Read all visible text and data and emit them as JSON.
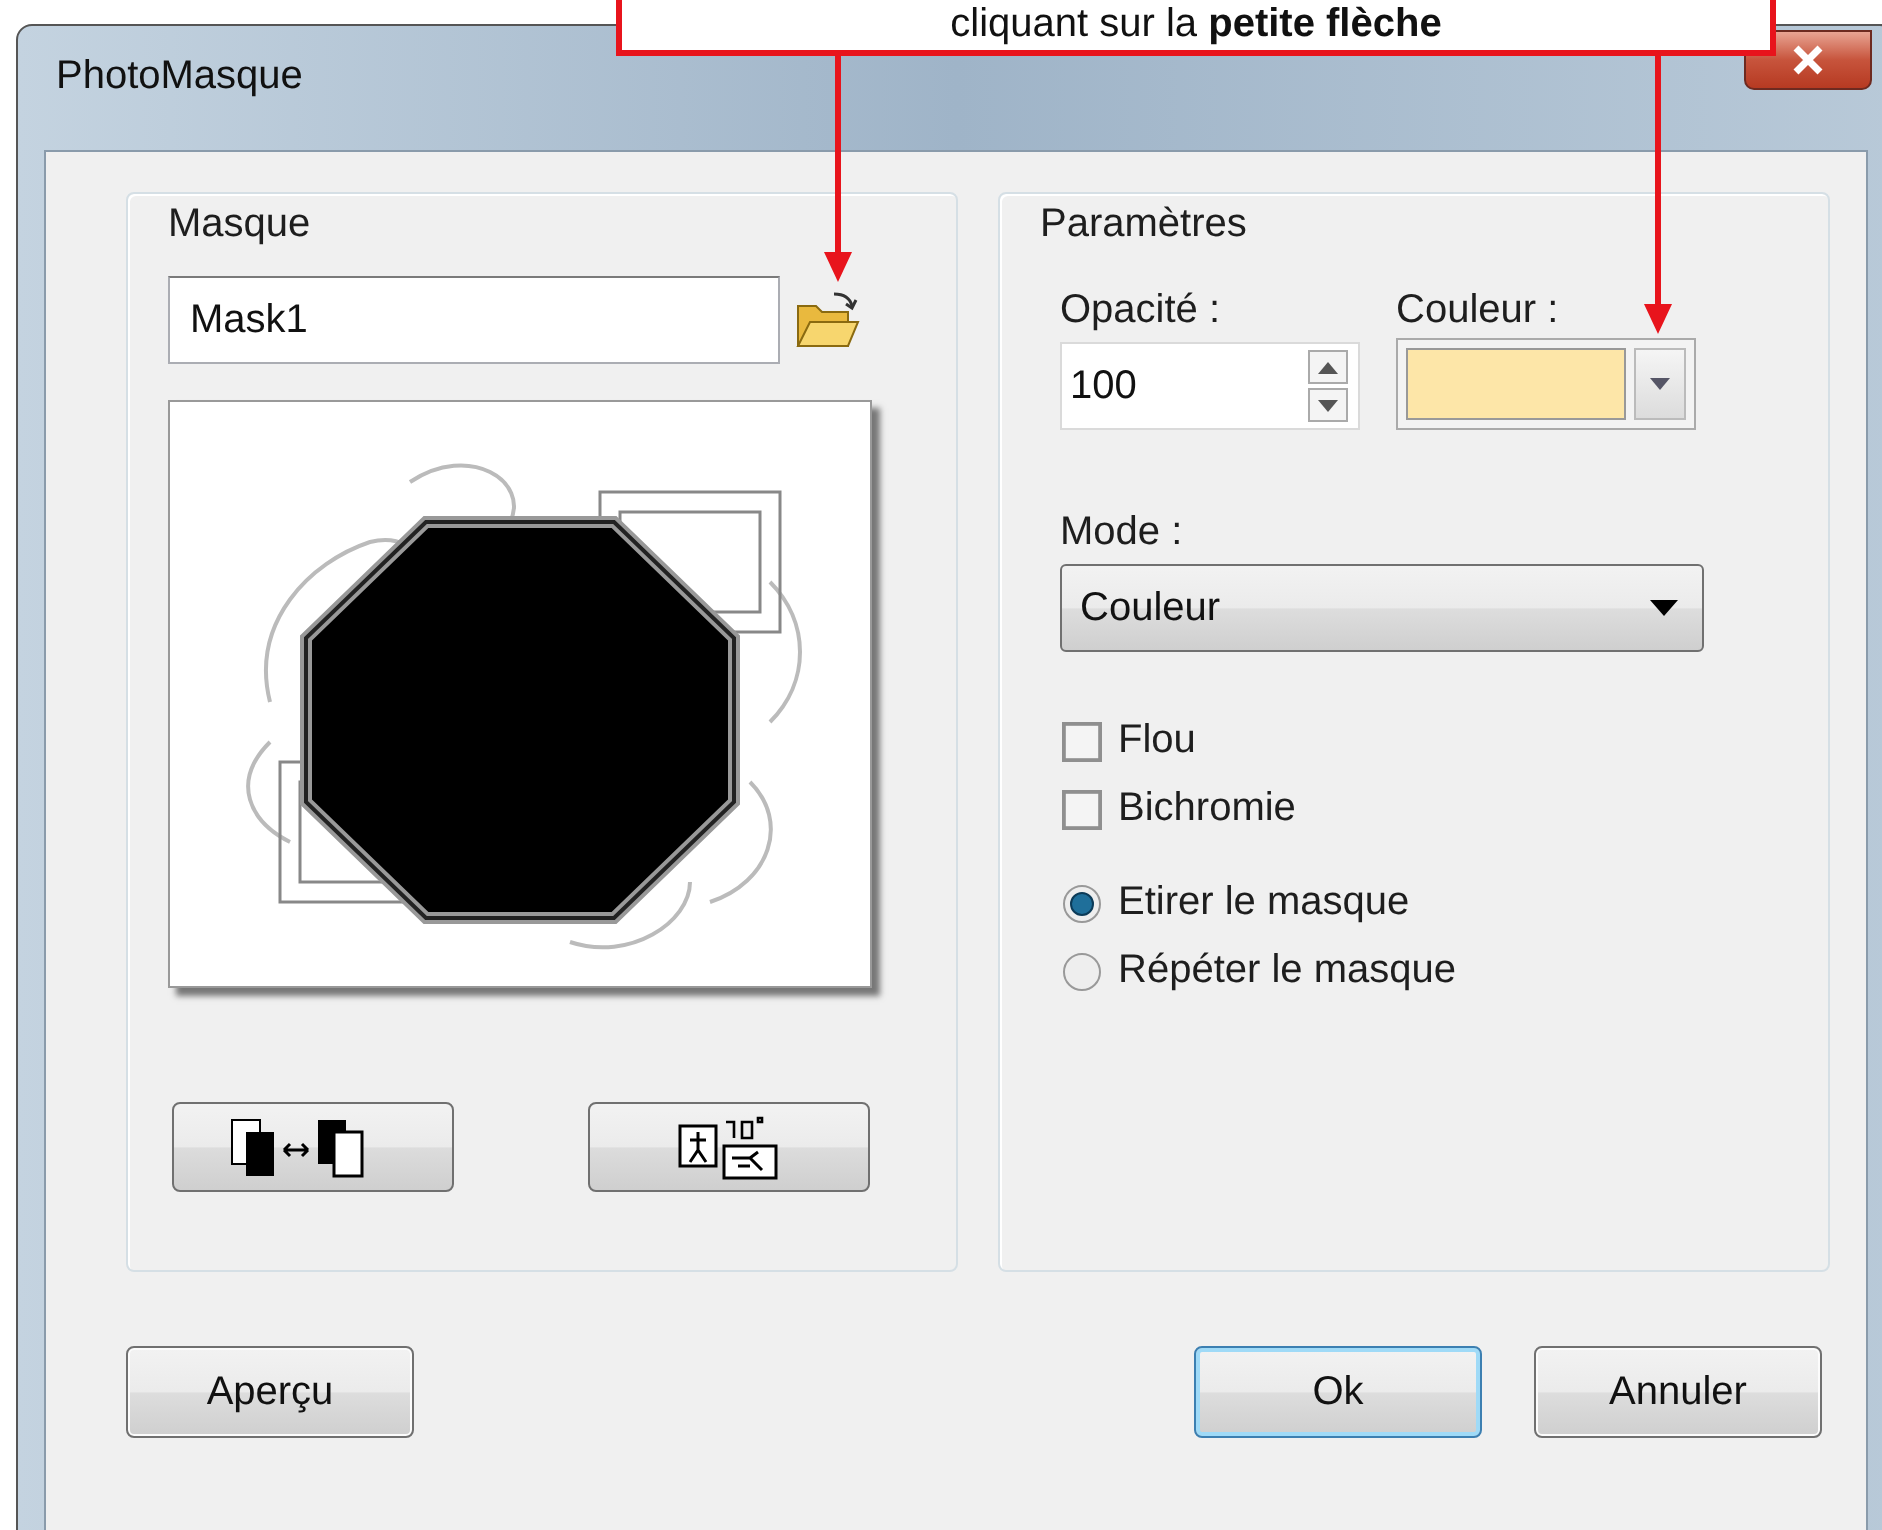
{
  "callout": {
    "text": "cliquant sur la **petite flèche**"
  },
  "window": {
    "title": "PhotoMasque"
  },
  "mask_group": {
    "title": "Masque",
    "name_field": {
      "value": "Mask1"
    }
  },
  "params_group": {
    "title": "Paramètres",
    "opacity": {
      "label": "Opacité :",
      "value": "100"
    },
    "color": {
      "label": "Couleur :",
      "color": "#fde6a8"
    },
    "mode": {
      "label": "Mode :",
      "value": "Couleur"
    },
    "checkboxes": [
      {
        "label": "Flou",
        "checked": false
      },
      {
        "label": "Bichromie",
        "checked": false
      }
    ],
    "radios": [
      {
        "label": "Etirer le masque",
        "selected": true
      },
      {
        "label": "Répéter le masque",
        "selected": false
      }
    ]
  },
  "buttons": [
    {
      "label": "Aperçu",
      "default": false
    },
    {
      "label": "Ok",
      "default": true
    },
    {
      "label": "Annuler",
      "default": false
    }
  ]
}
